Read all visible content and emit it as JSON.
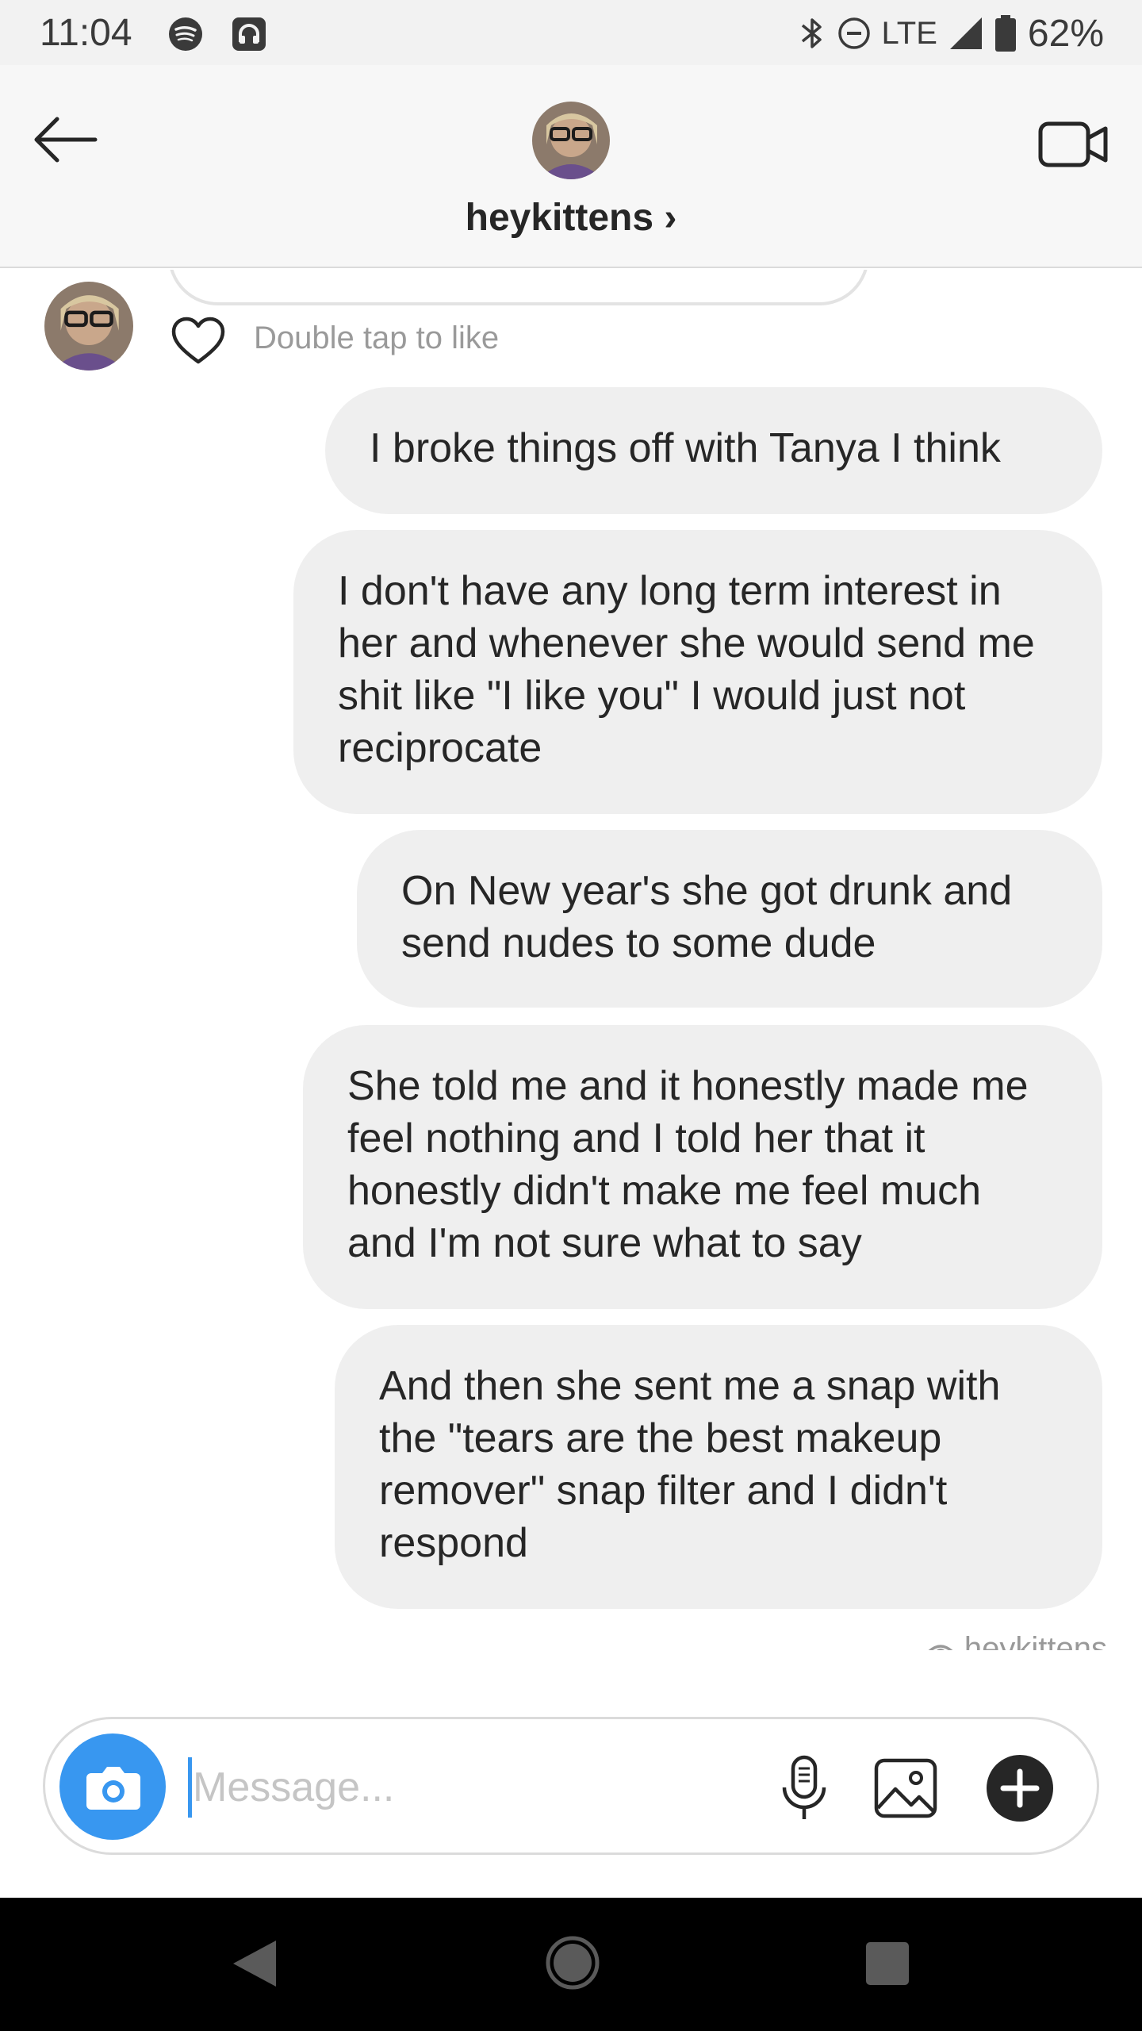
{
  "status_bar": {
    "time": "11:04",
    "network": "LTE",
    "battery": "62%",
    "icons": [
      "spotify-icon",
      "headphones-icon",
      "bluetooth-icon",
      "do-not-disturb-icon",
      "signal-icon",
      "battery-icon"
    ]
  },
  "header": {
    "username": "heykittens ›",
    "back_icon": "arrow-left-icon",
    "video_icon": "video-call-icon"
  },
  "thread": {
    "like_hint": "Double tap to like",
    "messages": [
      {
        "sender": "me",
        "text": "I broke things off with Tanya I think"
      },
      {
        "sender": "me",
        "text": "I don't have any long term interest in her and whenever she would send me shit like \"I like you\" I would just not reciprocate"
      },
      {
        "sender": "me",
        "text": "On New year's she got drunk and send nudes to some dude"
      },
      {
        "sender": "me",
        "text": "She told me and it honestly made me feel nothing and I told her that it honestly didn't make me feel much and I'm not sure what to say"
      },
      {
        "sender": "me",
        "text": "And then she sent me a snap with the \"tears are the best makeup remover\" snap filter and I didn't respond"
      }
    ],
    "seen_by": "heykittens"
  },
  "composer": {
    "placeholder": "Message...",
    "value": "",
    "icons": [
      "camera-icon",
      "microphone-icon",
      "gallery-icon",
      "plus-icon"
    ]
  },
  "colors": {
    "accent": "#3897f0",
    "bubble": "#efefef",
    "nav_bar": "#000000"
  }
}
